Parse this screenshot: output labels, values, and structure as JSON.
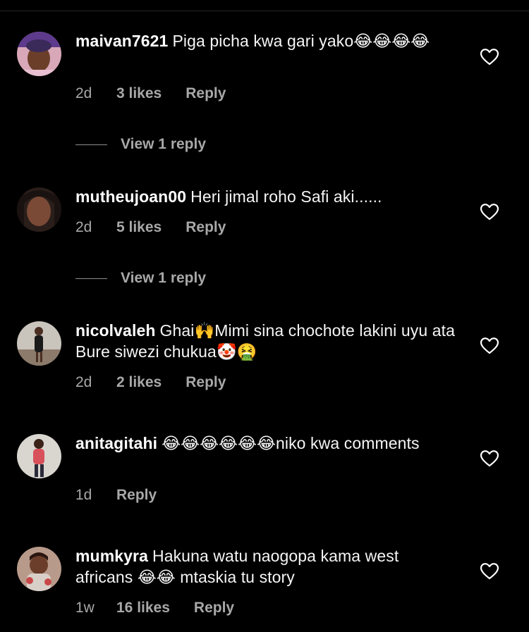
{
  "colors": {
    "background": "#000000",
    "primary_text": "#ffffff",
    "secondary_text": "#a8a8a8",
    "divider": "#262626"
  },
  "comments": [
    {
      "username": "maivan7621",
      "text": "Piga picha kwa gari yako😂😂😂😂",
      "time": "2d",
      "likes": "3 likes",
      "reply_label": "Reply",
      "view_replies": "View 1 reply",
      "avatar_icon": "avatar-photo-icon"
    },
    {
      "username": "mutheujoan00",
      "text": "Heri jimal roho Safi aki......",
      "time": "2d",
      "likes": "5 likes",
      "reply_label": "Reply",
      "view_replies": "View 1 reply",
      "avatar_icon": "avatar-photo-icon"
    },
    {
      "username": "nicolvaleh",
      "text": "Ghai🙌Mimi sina chochote lakini uyu ata Bure siwezi chukua🤡🤮",
      "time": "2d",
      "likes": "2 likes",
      "reply_label": "Reply",
      "avatar_icon": "avatar-photo-icon"
    },
    {
      "username": "anitagitahi",
      "text": "😂😂😂😂😂😂niko kwa comments",
      "time": "1d",
      "likes": "",
      "reply_label": "Reply",
      "avatar_icon": "avatar-photo-icon"
    },
    {
      "username": "mumkyra",
      "text": "Hakuna watu naogopa kama west africans 😂😂 mtaskia tu story",
      "time": "1w",
      "likes": "16 likes",
      "reply_label": "Reply",
      "avatar_icon": "avatar-photo-icon"
    }
  ],
  "like_icon": "heart-outline-icon"
}
